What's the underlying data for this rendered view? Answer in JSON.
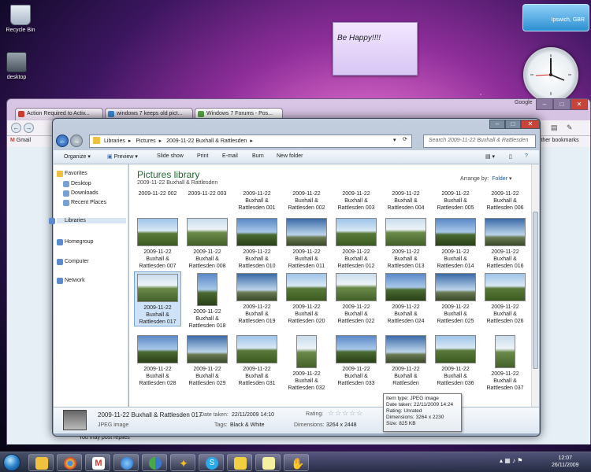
{
  "desktop": {
    "icons": [
      {
        "label": "Recycle Bin"
      },
      {
        "label": "desktop"
      }
    ],
    "sticky_note": "Be Happy!!!!",
    "weather": {
      "location": "Ipswich, GBR"
    }
  },
  "browser": {
    "tabs": [
      {
        "label": "Action Required to Activ..."
      },
      {
        "label": "windows 7 keeps old pict..."
      },
      {
        "label": "Windows 7 Forums - Pos..."
      }
    ],
    "bookmarks": [
      {
        "label": "Gmail"
      }
    ],
    "other_bookmarks": "Other bookmarks",
    "search_engine": "Google",
    "footer_text": "You may post replies"
  },
  "explorer": {
    "breadcrumb": [
      "Libraries",
      "Pictures",
      "2009-11-22 Buxhall & Rattlesden"
    ],
    "search_placeholder": "Search 2009-11-22 Buxhall & Rattlesden",
    "toolbar": [
      "Organize",
      "Preview",
      "Slide show",
      "Print",
      "E-mail",
      "Burn",
      "New folder"
    ],
    "nav": {
      "favorites": "Favorites",
      "favorites_items": [
        "Desktop",
        "Downloads",
        "Recent Places"
      ],
      "libraries": "Libraries",
      "homegroup": "Homegroup",
      "computer": "Computer",
      "network": "Network"
    },
    "library_title": "Pictures library",
    "library_subtitle": "2009-11-22 Buxhall & Rattlesden",
    "arrange_label": "Arrange by:",
    "arrange_value": "Folder",
    "top_row": [
      "2009-11-22 002",
      "2009-11-22 003",
      "2009-11-22 Buxhall & Rattlesden 001",
      "2009-11-22 Buxhall & Rattlesden 002",
      "2009-11-22 Buxhall & Rattlesden 003",
      "2009-11-22 Buxhall & Rattlesden 004",
      "2009-11-22 Buxhall & Rattlesden 005",
      "2009-11-22 Buxhall & Rattlesden 006"
    ],
    "rows": [
      [
        "2009-11-22 Buxhall & Rattlesden 007",
        "2009-11-22 Buxhall & Rattlesden 008",
        "2009-11-22 Buxhall & Rattlesden 010",
        "2009-11-22 Buxhall & Rattlesden 011",
        "2009-11-22 Buxhall & Rattlesden 012",
        "2009-11-22 Buxhall & Rattlesden 013",
        "2009-11-22 Buxhall & Rattlesden 014",
        "2009-11-22 Buxhall & Rattlesden 016"
      ],
      [
        "2009-11-22 Buxhall & Rattlesden 017",
        "2009-11-22 Buxhall & Rattlesden 018",
        "2009-11-22 Buxhall & Rattlesden 019",
        "2009-11-22 Buxhall & Rattlesden 020",
        "2009-11-22 Buxhall & Rattlesden 022",
        "2009-11-22 Buxhall & Rattlesden 024",
        "2009-11-22 Buxhall & Rattlesden 025",
        "2009-11-22 Buxhall & Rattlesden 026"
      ],
      [
        "2009-11-22 Buxhall & Rattlesden 028",
        "2009-11-22 Buxhall & Rattlesden 029",
        "2009-11-22 Buxhall & Rattlesden 031",
        "2009-11-22 Buxhall & Rattlesden 032",
        "2009-11-22 Buxhall & Rattlesden 033",
        "2009-11-22 Buxhall & Rattlesden",
        "2009-11-22 Buxhall & Rattlesden 036",
        "2009-11-22 Buxhall & Rattlesden 037"
      ]
    ],
    "details": {
      "title": "2009-11-22 Buxhall & Rattlesden 017",
      "type": "JPEG image",
      "date_label": "Date taken:",
      "date_value": "22/11/2009 14:10",
      "tags_label": "Tags:",
      "tags_value": "Black & White",
      "rating_label": "Rating:",
      "dimensions_label": "Dimensions:",
      "dimensions_value": "3264 x 2448"
    },
    "tooltip": [
      "Item type: JPEG image",
      "Date taken: 22/11/2009 14:24",
      "Rating: Unrated",
      "Dimensions: 3264 x 2230",
      "Size: 825 KB"
    ]
  },
  "taskbar": {
    "time": "12:07",
    "date": "26/11/2009"
  }
}
